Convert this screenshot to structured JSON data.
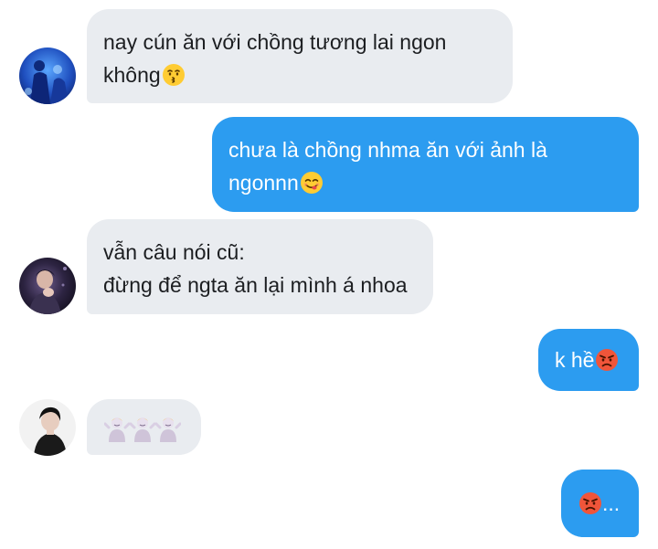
{
  "messages": [
    {
      "direction": "incoming",
      "lines": [
        "nay cún ăn với chồng tương lai ngon",
        "không"
      ],
      "trailing_emoji": "kissing-face-emoji"
    },
    {
      "direction": "outgoing",
      "lines": [
        "chưa là chồng nhma ăn với ảnh là",
        "ngonnn"
      ],
      "trailing_emoji": "yum-face-emoji"
    },
    {
      "direction": "incoming",
      "lines": [
        "vẫn câu nói cũ:",
        "đừng để ngta ăn lại mình á nhoa"
      ]
    },
    {
      "direction": "outgoing",
      "lines": [
        "k hề"
      ],
      "trailing_emoji": "angry-face-emoji"
    },
    {
      "direction": "incoming",
      "emojis": [
        "person-shrugging-emoji",
        "person-shrugging-emoji",
        "person-shrugging-emoji"
      ]
    },
    {
      "direction": "outgoing",
      "leading_emoji": "angry-face-emoji",
      "text": "..."
    }
  ],
  "colors": {
    "incoming_bubble": "#e9ecf0",
    "outgoing_bubble": "#2c9cf0",
    "incoming_text": "#1c1e21",
    "outgoing_text": "#ffffff"
  }
}
